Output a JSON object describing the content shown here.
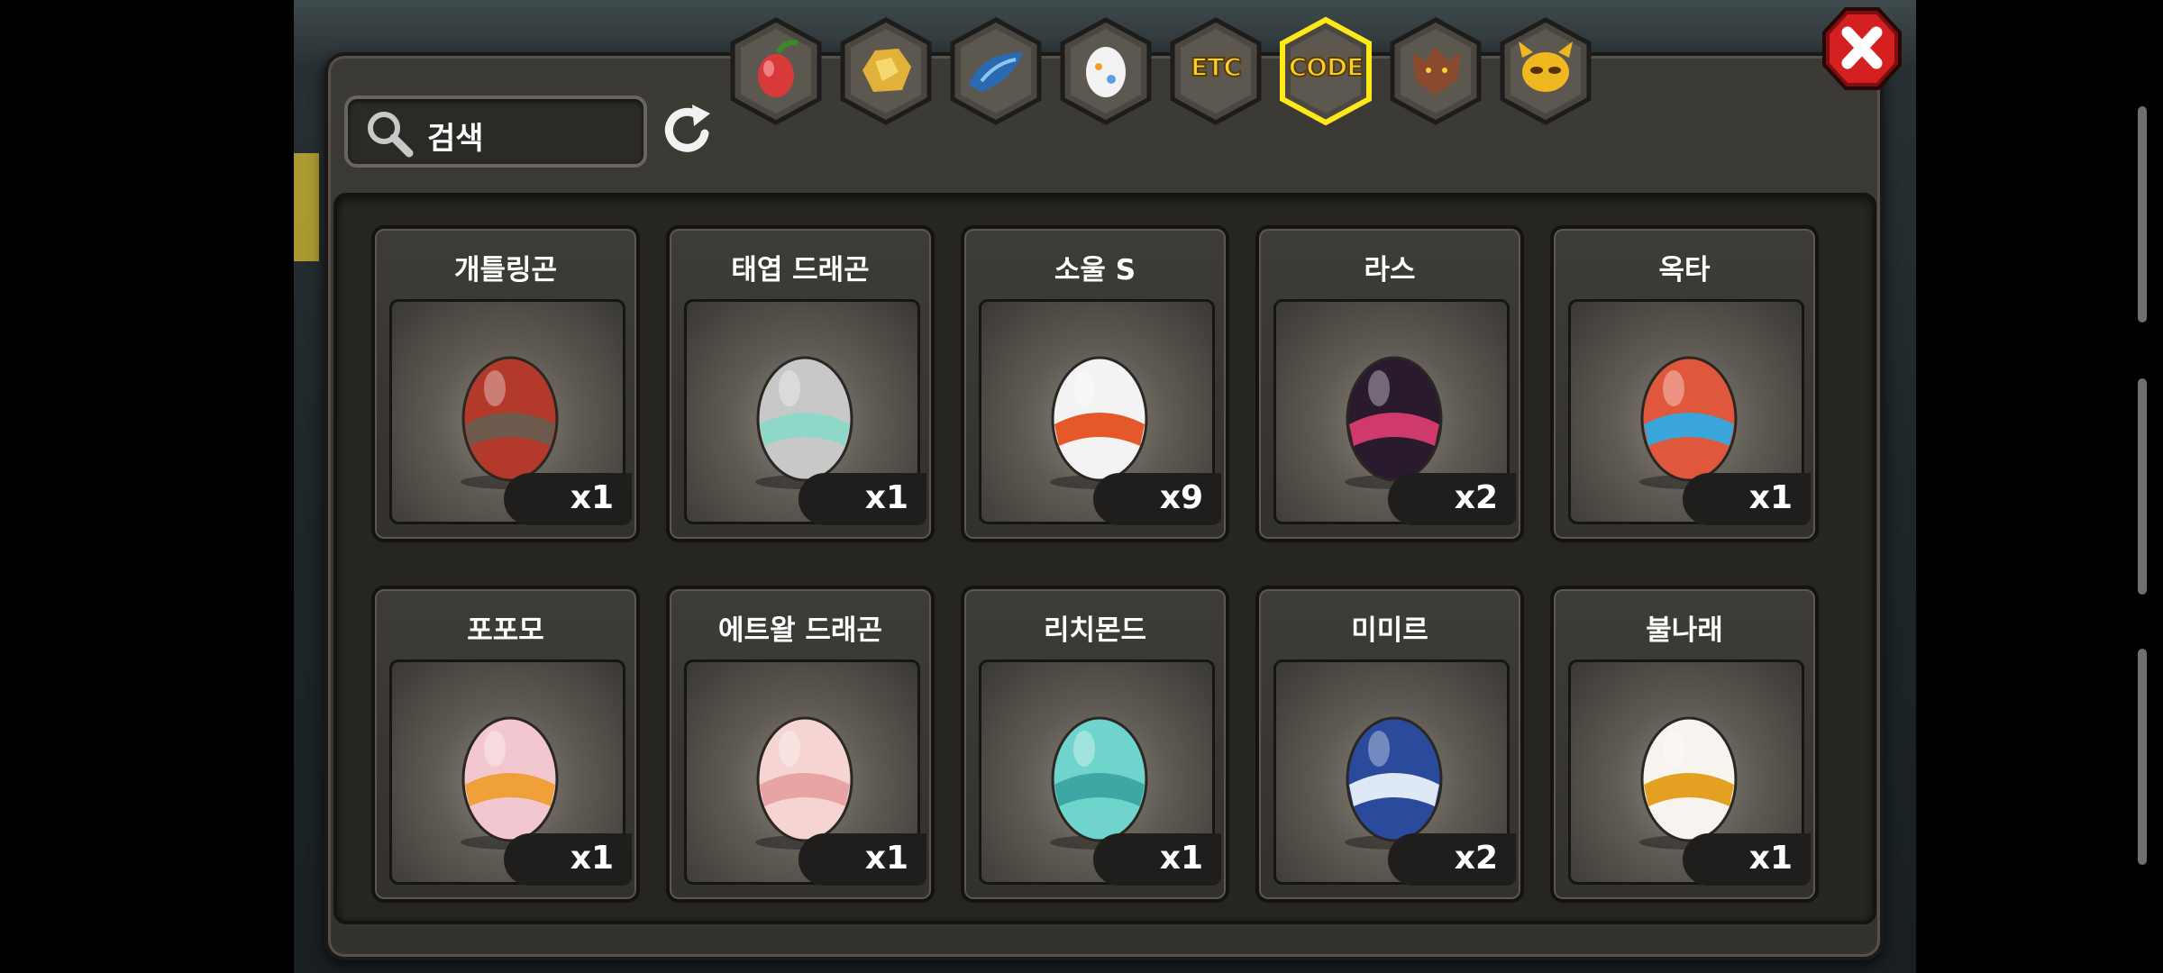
{
  "search": {
    "placeholder": "검색",
    "icon": "search-icon"
  },
  "refresh": {
    "icon": "refresh-icon"
  },
  "tabs": [
    {
      "icon": "fruit-icon",
      "label": "",
      "selected": false
    },
    {
      "icon": "gold-ore-icon",
      "label": "",
      "selected": false
    },
    {
      "icon": "dragon-scale-icon",
      "label": "",
      "selected": false
    },
    {
      "icon": "egg-icon",
      "label": "",
      "selected": false
    },
    {
      "icon": "etc-icon",
      "label": "ETC",
      "selected": false
    },
    {
      "icon": "code-icon",
      "label": "CODE",
      "selected": true
    },
    {
      "icon": "wolf-icon",
      "label": "",
      "selected": false
    },
    {
      "icon": "demon-mask-icon",
      "label": "",
      "selected": false
    }
  ],
  "items": [
    {
      "name": "개틀링곤",
      "count": "x1",
      "egg": "gatling-egg-icon",
      "colors": [
        "#b33a2a",
        "#6d5a4c"
      ]
    },
    {
      "name": "태엽 드래곤",
      "count": "x1",
      "egg": "windup-egg-icon",
      "colors": [
        "#c8c8c8",
        "#8fd8c8"
      ]
    },
    {
      "name": "소울 S",
      "count": "x9",
      "egg": "soul-egg-icon",
      "colors": [
        "#f3f3f3",
        "#e4582a"
      ]
    },
    {
      "name": "라스",
      "count": "x2",
      "egg": "lars-egg-icon",
      "colors": [
        "#2a1a2e",
        "#d03a6a"
      ]
    },
    {
      "name": "옥타",
      "count": "x1",
      "egg": "octa-egg-icon",
      "colors": [
        "#e0583c",
        "#3aa5d8"
      ]
    },
    {
      "name": "포포모",
      "count": "x1",
      "egg": "popomo-egg-icon",
      "colors": [
        "#f3c7cf",
        "#f0a038"
      ]
    },
    {
      "name": "에트왈 드래곤",
      "count": "x1",
      "egg": "etoile-egg-icon",
      "colors": [
        "#f6d4d2",
        "#e8a4a4"
      ]
    },
    {
      "name": "리치몬드",
      "count": "x1",
      "egg": "richmond-egg-icon",
      "colors": [
        "#6fd4cc",
        "#3ea7a4"
      ]
    },
    {
      "name": "미미르",
      "count": "x2",
      "egg": "mimir-egg-icon",
      "colors": [
        "#2a4a9c",
        "#dfe9f6"
      ]
    },
    {
      "name": "불나래",
      "count": "x1",
      "egg": "bulnarae-egg-icon",
      "colors": [
        "#f7f3ee",
        "#e4a020"
      ]
    }
  ],
  "close": {
    "icon": "close-icon"
  }
}
